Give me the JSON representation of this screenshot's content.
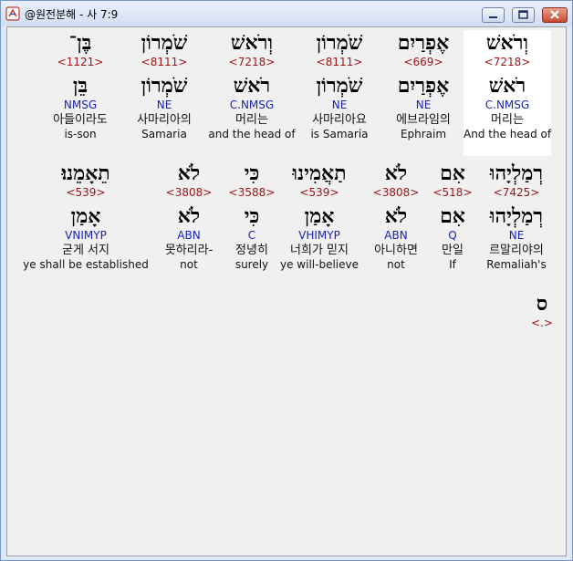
{
  "window": {
    "title": "@원전분해 - 사 7:9"
  },
  "rows": [
    {
      "words": [
        {
          "hebrew": "וְרֹאשׁ",
          "strong": "<7218>",
          "lemma": "רֹאשׁ",
          "morph": "C.NMSG",
          "korean": "머리는",
          "english": "And the head of",
          "selected": true
        },
        {
          "hebrew": "אֶפְרַיִם",
          "strong": "<669>",
          "lemma": "אֶפְרַיִם",
          "morph": "NE",
          "korean": "에브라임의",
          "english": "Ephraim"
        },
        {
          "hebrew": "שֹׁמְרוֹן",
          "strong": "<8111>",
          "lemma": "שֹׁמְרוֹן",
          "morph": "NE",
          "korean": "사마리아요",
          "english": "is Samaria"
        },
        {
          "hebrew": "וְרֹאשׁ",
          "strong": "<7218>",
          "lemma": "רֹאשׁ",
          "morph": "C.NMSG",
          "korean": "머리는",
          "english": "and the head of"
        },
        {
          "hebrew": "שֹׁמְרוֹן",
          "strong": "<8111>",
          "lemma": "שֹׁמְרוֹן",
          "morph": "NE",
          "korean": "사마리아의",
          "english": "Samaria"
        },
        {
          "hebrew": "בֶּן־",
          "strong": "<1121>",
          "lemma": "בֵּן",
          "morph": "NMSG",
          "korean": "아들이라도",
          "english": "is-son"
        }
      ]
    },
    {
      "words": [
        {
          "hebrew": "רְמַלְיָהוּ",
          "strong": "<7425>",
          "lemma": "רְמַלְיָהוּ",
          "morph": "NE",
          "korean": "르말리야의",
          "english": "Remaliah's"
        },
        {
          "hebrew": "אִם",
          "strong": "<518>",
          "lemma": "אִם",
          "morph": "Q",
          "korean": "만일",
          "english": "If"
        },
        {
          "hebrew": "לֹא",
          "strong": "<3808>",
          "lemma": "לֹא",
          "morph": "ABN",
          "korean": "아니하면",
          "english": "not"
        },
        {
          "hebrew": "תַאֲמִינוּ",
          "strong": "<539>",
          "lemma": "אָמַן",
          "morph": "VHIMYP",
          "korean": "너희가 믿지",
          "english": "ye will-believe"
        },
        {
          "hebrew": "כִּי",
          "strong": "<3588>",
          "lemma": "כִּי",
          "morph": "C",
          "korean": "정녕히",
          "english": "surely"
        },
        {
          "hebrew": "לֹא",
          "strong": "<3808>",
          "lemma": "לֹא",
          "morph": "ABN",
          "korean": "못하리라-",
          "english": "not"
        },
        {
          "hebrew": "תֵאָמֵנוּ׃",
          "strong": "<539>",
          "lemma": "אָמַן",
          "morph": "VNIMYP",
          "korean": "굳게 서지",
          "english": "ye shall be established"
        }
      ]
    },
    {
      "words": [
        {
          "hebrew": "ס",
          "strong": "<.>"
        }
      ]
    }
  ]
}
